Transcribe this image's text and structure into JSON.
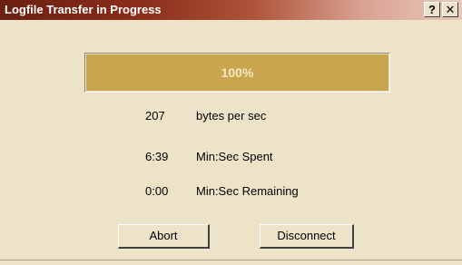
{
  "window": {
    "title": "Logfile Transfer in Progress",
    "help_glyph": "?",
    "close_glyph": "✕"
  },
  "progress": {
    "fraction": 1.0,
    "text": "100%",
    "fill_color": "#c9a64e"
  },
  "stats": [
    {
      "value": "207",
      "label": "bytes per sec"
    },
    {
      "value": "6:39",
      "label": "Min:Sec Spent"
    },
    {
      "value": "0:00",
      "label": "Min:Sec Remaining"
    }
  ],
  "buttons": {
    "abort": "Abort",
    "disconnect": "Disconnect"
  },
  "colors": {
    "dialog_bg": "#ece3c8",
    "titlebar_start": "#6a1f12",
    "titlebar_end": "#e9c8bd"
  }
}
